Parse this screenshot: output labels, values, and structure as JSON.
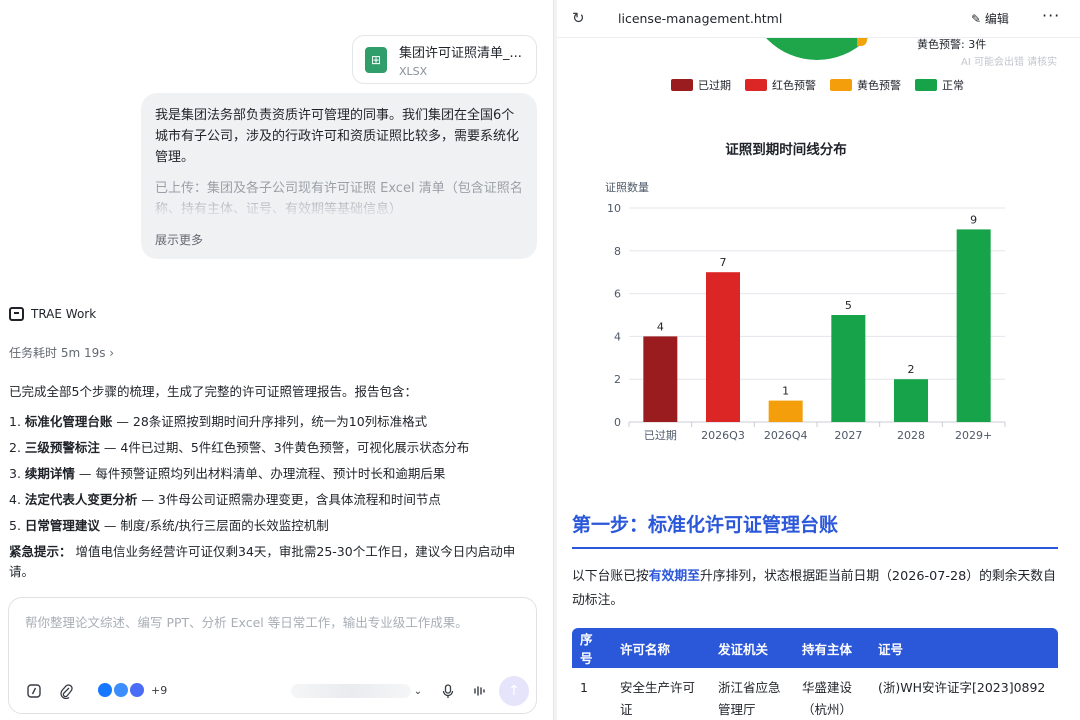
{
  "attachment": {
    "name": "集团许可证照清单_...",
    "type": "XLSX",
    "icon": "spreadsheet-icon"
  },
  "user_message": {
    "paragraph1": "我是集团法务部负责资质许可管理的同事。我们集团在全国6个城市有子公司，涉及的行政许可和资质证照比较多，需要系统化管理。",
    "paragraph2": "已上传：集团及各子公司现有许可证照 Excel 清单（包含证照名称、持有主体、证号、有效期等基础信息）",
    "show_more": "展示更多"
  },
  "agent": {
    "name": "TRAE Work",
    "duration": "任务耗时 5m 19s ›"
  },
  "summary": {
    "intro": "已完成全部5个步骤的梳理，生成了完整的许可证照管理报告。报告包含：",
    "items": [
      {
        "num": "1.",
        "title": "标准化管理台账",
        "desc": " — 28条证照按到期时间升序排列，统一为10列标准格式"
      },
      {
        "num": "2.",
        "title": "三级预警标注",
        "desc": " — 4件已过期、5件红色预警、3件黄色预警，可视化展示状态分布"
      },
      {
        "num": "3.",
        "title": "续期详情",
        "desc": " — 每件预警证照均列出材料清单、办理流程、预计时长和逾期后果"
      },
      {
        "num": "4.",
        "title": "法定代表人变更分析",
        "desc": " — 3件母公司证照需办理变更，含具体流程和时间节点"
      },
      {
        "num": "5.",
        "title": "日常管理建议",
        "desc": " — 制度/系统/执行三层面的长效监控机制"
      }
    ],
    "urgent_label": "紧急提示：",
    "urgent_text": " 增值电信业务经营许可证仅剩34天，审批需25-30个工作日，建议今日内启动申请。"
  },
  "composer": {
    "placeholder": "帮你整理论文综述、编写 PPT、分析 Excel 等日常工作，输出专业级工作成果。",
    "model_more": "+9"
  },
  "preview": {
    "file_tab": "license-management.html",
    "edit_label": "编辑",
    "more_label": "···",
    "peek_text": "黄色预警: 3件",
    "ai_note": "AI 可能会出错 请核实",
    "legend": [
      {
        "label": "已过期",
        "color": "#9b1c1f"
      },
      {
        "label": "红色预警",
        "color": "#dc2626"
      },
      {
        "label": "黄色预警",
        "color": "#f59e0b"
      },
      {
        "label": "正常",
        "color": "#16a34a"
      }
    ],
    "step_title": "第一步：标准化许可证管理台账",
    "intro_before": "以下台账已按",
    "intro_highlight": "有效期至",
    "intro_after": "升序排列，状态根据距当前日期（2026-07-28）的剩余天数自动标注。",
    "table": {
      "headers": [
        "序号",
        "许可名称",
        "发证机关",
        "持有主体",
        "证号"
      ],
      "rows": [
        [
          "1",
          "安全生产许可证",
          "浙江省应急管理厅",
          "华盛建设（杭州）",
          "(浙)WH安许证字[2023]0892"
        ]
      ]
    }
  },
  "chart_data": {
    "type": "bar",
    "title": "证照到期时间线分布",
    "ylabel": "证照数量",
    "xlabel": "",
    "categories": [
      "已过期",
      "2026Q3",
      "2026Q4",
      "2027",
      "2028",
      "2029+"
    ],
    "values": [
      4,
      7,
      1,
      5,
      2,
      9
    ],
    "colors": [
      "#9b1c1f",
      "#dc2626",
      "#f59e0b",
      "#16a34a",
      "#16a34a",
      "#16a34a"
    ],
    "ylim": [
      0,
      10
    ],
    "yticks": [
      0,
      2,
      4,
      6,
      8,
      10
    ],
    "grid": true,
    "legend": "top"
  }
}
